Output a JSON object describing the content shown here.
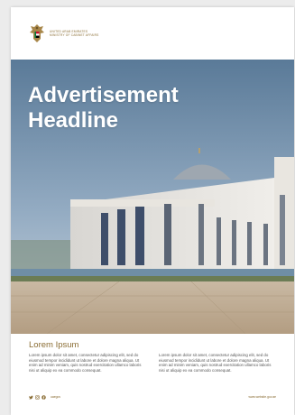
{
  "header": {
    "org_line1": "UNITED ARAB EMIRATES",
    "org_line2": "MINISTRY OF CABINET AFFAIRS",
    "emblem_icon": "uae-emblem-icon"
  },
  "hero": {
    "headline_line1": "Advertisement",
    "headline_line2": "Headline",
    "image": "white-mosque-building-photo"
  },
  "body": {
    "subheading": "Lorem Ipsum",
    "column1": "Lorem ipsum dolor sit amet, consectetur adipiscing elit, sed do eiusmod tempor incididunt ut labore et dolore magna aliqua. Ut enim ad minim veniam, quis nostrud exercitation ullamco laboris nisi ut aliquip ex ea commodo consequat.",
    "column2": "Lorem ipsum dolor sit amet, consectetur adipiscing elit, sed do eiusmod tempor incididunt ut labore et dolore magna aliqua. Ut enim ad minim veniam, quis nostrud exercitation ullamco laboris nisi ut aliquip ex ea commodo consequat."
  },
  "footer": {
    "social_icons": [
      "twitter-icon",
      "instagram-icon",
      "facebook-icon"
    ],
    "handle": "uaegov",
    "website": "www.website.gov.ae"
  },
  "colors": {
    "accent_gold": "#8a6d34",
    "page_background": "#ffffff",
    "canvas_background": "#ececec"
  }
}
